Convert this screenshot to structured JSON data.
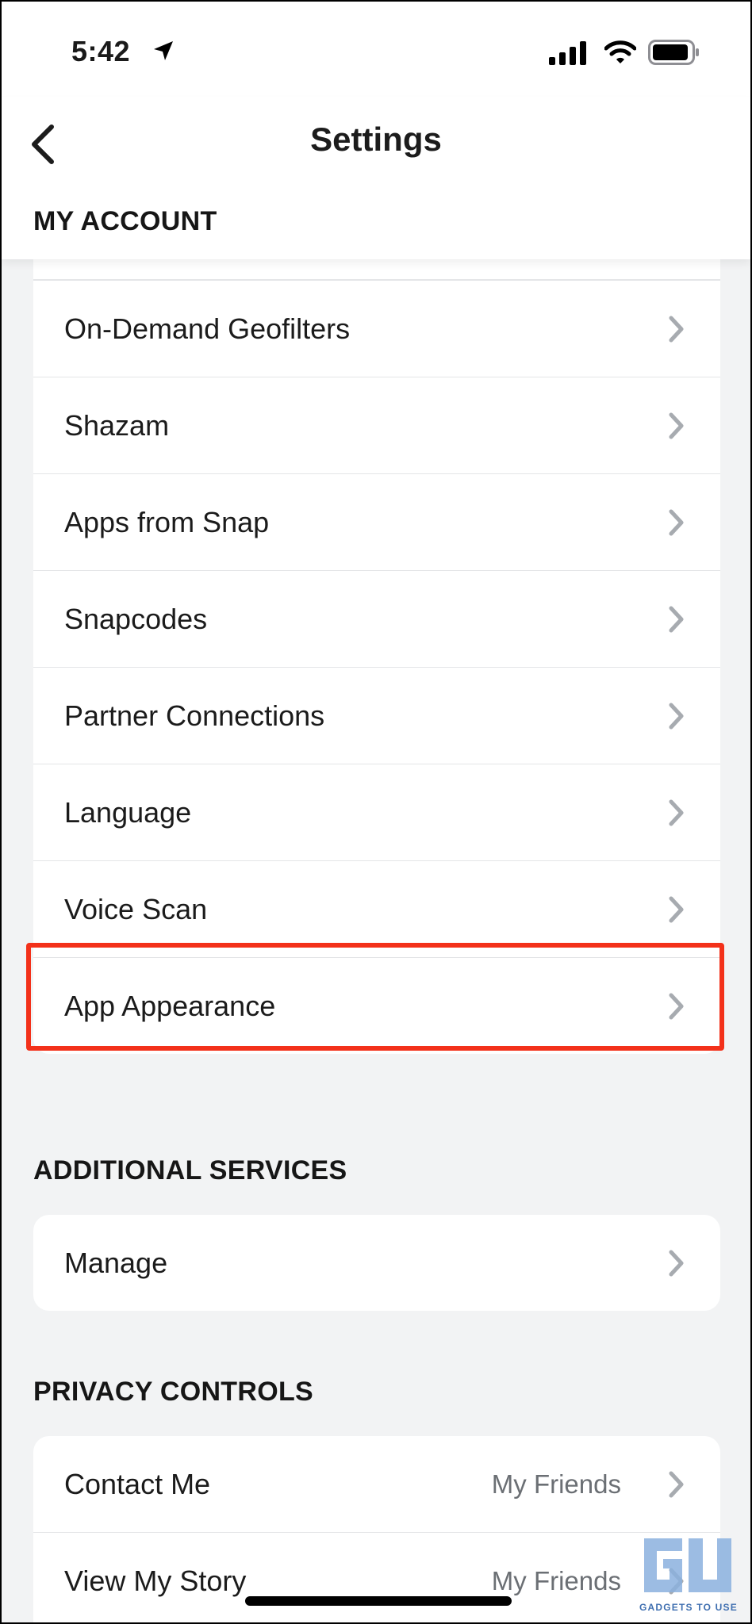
{
  "status_bar": {
    "time": "5:42"
  },
  "header": {
    "title": "Settings"
  },
  "sections": {
    "my_account": {
      "title": "MY ACCOUNT",
      "items": [
        {
          "label": "On-Demand Geofilters"
        },
        {
          "label": "Shazam"
        },
        {
          "label": "Apps from Snap"
        },
        {
          "label": "Snapcodes"
        },
        {
          "label": "Partner Connections"
        },
        {
          "label": "Language"
        },
        {
          "label": "Voice Scan"
        },
        {
          "label": "App Appearance"
        }
      ]
    },
    "additional_services": {
      "title": "ADDITIONAL SERVICES",
      "items": [
        {
          "label": "Manage"
        }
      ]
    },
    "privacy_controls": {
      "title": "PRIVACY CONTROLS",
      "items": [
        {
          "label": "Contact Me",
          "value": "My Friends"
        },
        {
          "label": "View My Story",
          "value": "My Friends"
        }
      ]
    }
  },
  "watermark": {
    "text": "GADGETS TO USE"
  },
  "colors": {
    "highlight": "#f3311a",
    "chevron": "#a7abb0",
    "background": "#f2f3f4"
  },
  "icons": [
    "location-arrow-icon",
    "signal-icon",
    "wifi-icon",
    "battery-icon",
    "back-chevron-icon",
    "chevron-right-icon"
  ]
}
